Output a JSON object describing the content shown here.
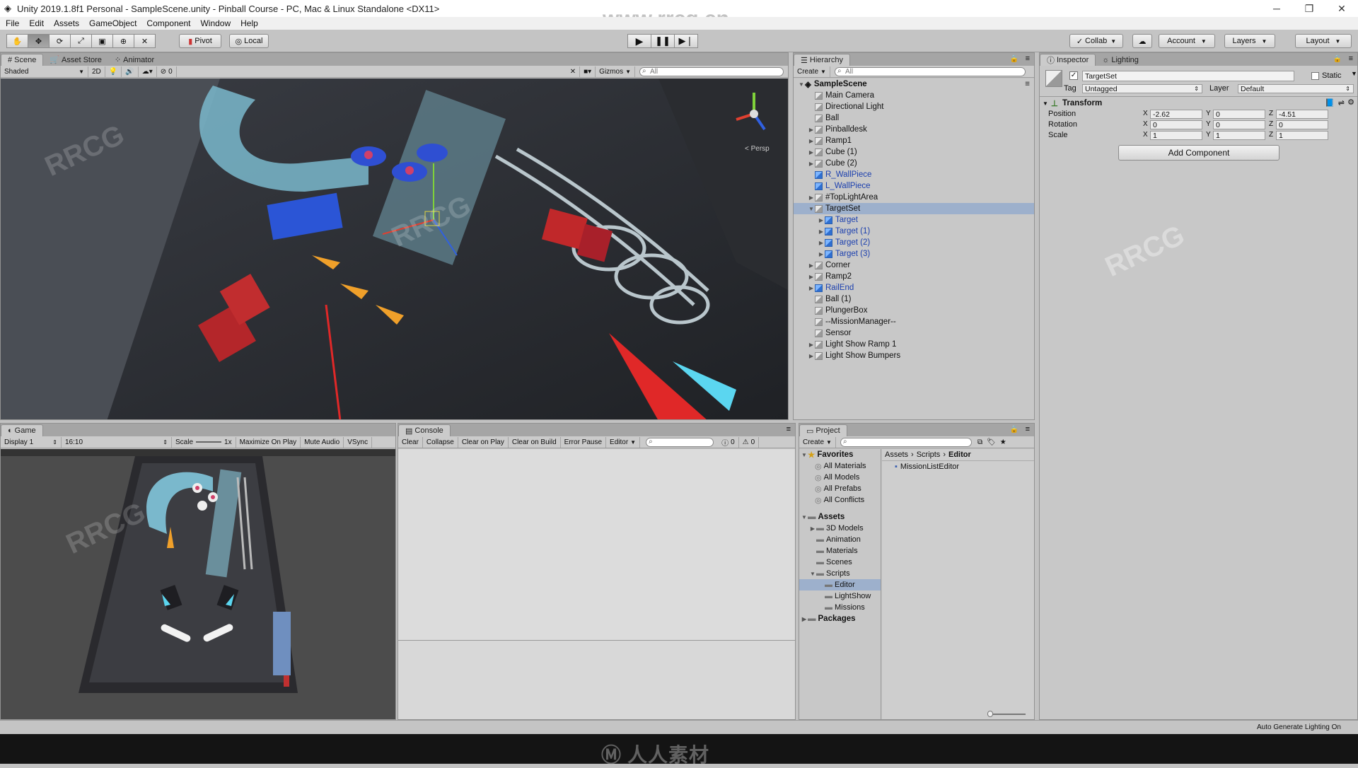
{
  "window": {
    "title": "Unity 2019.1.8f1 Personal - SampleScene.unity - Pinball Course - PC, Mac & Linux Standalone <DX11>",
    "controls": [
      "─",
      "❐",
      "✕"
    ]
  },
  "watermark_site": "www.rrcg.cn",
  "menu": [
    "File",
    "Edit",
    "Assets",
    "GameObject",
    "Component",
    "Window",
    "Help"
  ],
  "toolbar": {
    "pivot": "Pivot",
    "local": "Local",
    "collab": "Collab",
    "account": "Account",
    "layers": "Layers",
    "layout": "Layout"
  },
  "scene_panel": {
    "tabs": [
      "Scene",
      "Asset Store",
      "Animator"
    ],
    "shading": "Shaded",
    "mode2d": "2D",
    "fx_count": "0",
    "gizmos": "Gizmos",
    "search_placeholder": "All",
    "persp_label": "< Persp"
  },
  "hierarchy": {
    "tab": "Hierarchy",
    "create": "Create",
    "search_placeholder": "All",
    "scene": "SampleScene",
    "items": [
      {
        "label": "Main Camera",
        "depth": 1,
        "arrow": "",
        "prefab": false
      },
      {
        "label": "Directional Light",
        "depth": 1,
        "arrow": "",
        "prefab": false
      },
      {
        "label": "Ball",
        "depth": 1,
        "arrow": "",
        "prefab": false
      },
      {
        "label": "Pinballdesk",
        "depth": 1,
        "arrow": "▶",
        "prefab": false
      },
      {
        "label": "Ramp1",
        "depth": 1,
        "arrow": "▶",
        "prefab": false
      },
      {
        "label": "Cube (1)",
        "depth": 1,
        "arrow": "▶",
        "prefab": false
      },
      {
        "label": "Cube (2)",
        "depth": 1,
        "arrow": "▶",
        "prefab": false
      },
      {
        "label": "R_WallPiece",
        "depth": 1,
        "arrow": "",
        "prefab": true
      },
      {
        "label": "L_WallPiece",
        "depth": 1,
        "arrow": "",
        "prefab": true
      },
      {
        "label": "#TopLightArea",
        "depth": 1,
        "arrow": "▶",
        "prefab": false
      },
      {
        "label": "TargetSet",
        "depth": 1,
        "arrow": "▼",
        "prefab": false,
        "selected": true
      },
      {
        "label": "Target",
        "depth": 2,
        "arrow": "▶",
        "prefab": true
      },
      {
        "label": "Target (1)",
        "depth": 2,
        "arrow": "▶",
        "prefab": true
      },
      {
        "label": "Target (2)",
        "depth": 2,
        "arrow": "▶",
        "prefab": true
      },
      {
        "label": "Target (3)",
        "depth": 2,
        "arrow": "▶",
        "prefab": true
      },
      {
        "label": "Corner",
        "depth": 1,
        "arrow": "▶",
        "prefab": false
      },
      {
        "label": "Ramp2",
        "depth": 1,
        "arrow": "▶",
        "prefab": false
      },
      {
        "label": "RailEnd",
        "depth": 1,
        "arrow": "▶",
        "prefab": true
      },
      {
        "label": "Ball (1)",
        "depth": 1,
        "arrow": "",
        "prefab": false
      },
      {
        "label": "PlungerBox",
        "depth": 1,
        "arrow": "",
        "prefab": false
      },
      {
        "label": "--MissionManager--",
        "depth": 1,
        "arrow": "",
        "prefab": false
      },
      {
        "label": "Sensor",
        "depth": 1,
        "arrow": "",
        "prefab": false
      },
      {
        "label": "Light Show Ramp 1",
        "depth": 1,
        "arrow": "▶",
        "prefab": false
      },
      {
        "label": "Light Show Bumpers",
        "depth": 1,
        "arrow": "▶",
        "prefab": false
      }
    ]
  },
  "inspector": {
    "tabs": [
      "Inspector",
      "Lighting"
    ],
    "object_name": "TargetSet",
    "static_label": "Static",
    "tag_label": "Tag",
    "tag_value": "Untagged",
    "layer_label": "Layer",
    "layer_value": "Default",
    "transform_title": "Transform",
    "axis": [
      "X",
      "Y",
      "Z"
    ],
    "rows": [
      {
        "label": "Position",
        "x": "-2.62",
        "y": "0",
        "z": "-4.51"
      },
      {
        "label": "Rotation",
        "x": "0",
        "y": "0",
        "z": "0"
      },
      {
        "label": "Scale",
        "x": "1",
        "y": "1",
        "z": "1"
      }
    ],
    "add_component": "Add Component"
  },
  "game_panel": {
    "tab": "Game",
    "display": "Display 1",
    "aspect": "16:10",
    "scale_label": "Scale",
    "scale_value": "1x",
    "maximize": "Maximize On Play",
    "mute": "Mute Audio",
    "vsync": "VSync"
  },
  "console_panel": {
    "tab": "Console",
    "buttons": [
      "Clear",
      "Collapse",
      "Clear on Play",
      "Clear on Build",
      "Error Pause",
      "Editor"
    ],
    "info_count": "0",
    "warn_count": "0"
  },
  "project_panel": {
    "tab": "Project",
    "create": "Create",
    "favorites_title": "Favorites",
    "favorites": [
      "All Materials",
      "All Models",
      "All Prefabs",
      "All Conflicts"
    ],
    "assets_title": "Assets",
    "assets": [
      {
        "label": "3D Models",
        "depth": 1,
        "arrow": "▶"
      },
      {
        "label": "Animation",
        "depth": 1,
        "arrow": ""
      },
      {
        "label": "Materials",
        "depth": 1,
        "arrow": ""
      },
      {
        "label": "Scenes",
        "depth": 1,
        "arrow": ""
      },
      {
        "label": "Scripts",
        "depth": 1,
        "arrow": "▼"
      },
      {
        "label": "Editor",
        "depth": 2,
        "arrow": "",
        "selected": true
      },
      {
        "label": "LightShow",
        "depth": 2,
        "arrow": ""
      },
      {
        "label": "Missions",
        "depth": 2,
        "arrow": ""
      }
    ],
    "packages_title": "Packages",
    "breadcrumb": [
      "Assets",
      "Scripts",
      "Editor"
    ],
    "files": [
      "MissionListEditor"
    ]
  },
  "statusbar": {
    "right": "Auto Generate Lighting On"
  },
  "taskbar": {
    "brand": "人人素材"
  },
  "colors": {
    "accent_selected": "#9db0cc",
    "prefab_blue": "#1b3fae",
    "scene_bg": "#2b2d31"
  }
}
